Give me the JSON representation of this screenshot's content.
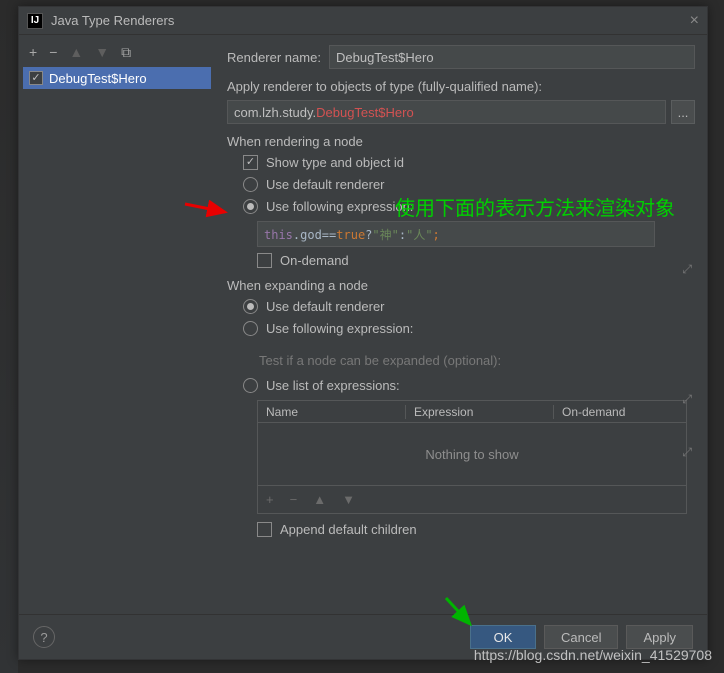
{
  "title": "Java Type Renderers",
  "logoLetters": "IJ",
  "leftPane": {
    "item": "DebugTest$Hero"
  },
  "rendererName": {
    "label": "Renderer name:",
    "value": "DebugTest$Hero"
  },
  "applyLabel": "Apply renderer to objects of type (fully-qualified name):",
  "qualifiedName": {
    "prefix": "com.lzh.study.",
    "suffix": "DebugTest$Hero",
    "btn": "..."
  },
  "renderNode": {
    "heading": "When rendering a node",
    "showTypeId": "Show type and object id",
    "useDefault": "Use default renderer",
    "useExpr": "Use following expression:",
    "expr": {
      "p1": "this",
      "p2": ".god==",
      "p3": "true",
      "p4": "?",
      "p5": "\"神\"",
      "p6": ":",
      "p7": "\"人\"",
      "p8": ";"
    },
    "onDemand": "On-demand"
  },
  "expandNode": {
    "heading": "When expanding a node",
    "useDefault": "Use default renderer",
    "useExpr": "Use following expression:",
    "testLabel": "Test if a node can be expanded (optional):",
    "useList": "Use list of expressions:"
  },
  "table": {
    "cols": {
      "name": "Name",
      "expr": "Expression",
      "onDemand": "On-demand"
    },
    "empty": "Nothing to show"
  },
  "appendChildren": "Append default children",
  "buttons": {
    "help": "?",
    "ok": "OK",
    "cancel": "Cancel",
    "apply": "Apply"
  },
  "annotation": "使用下面的表示方法来渲染对象",
  "watermark": "https://blog.csdn.net/weixin_41529708"
}
